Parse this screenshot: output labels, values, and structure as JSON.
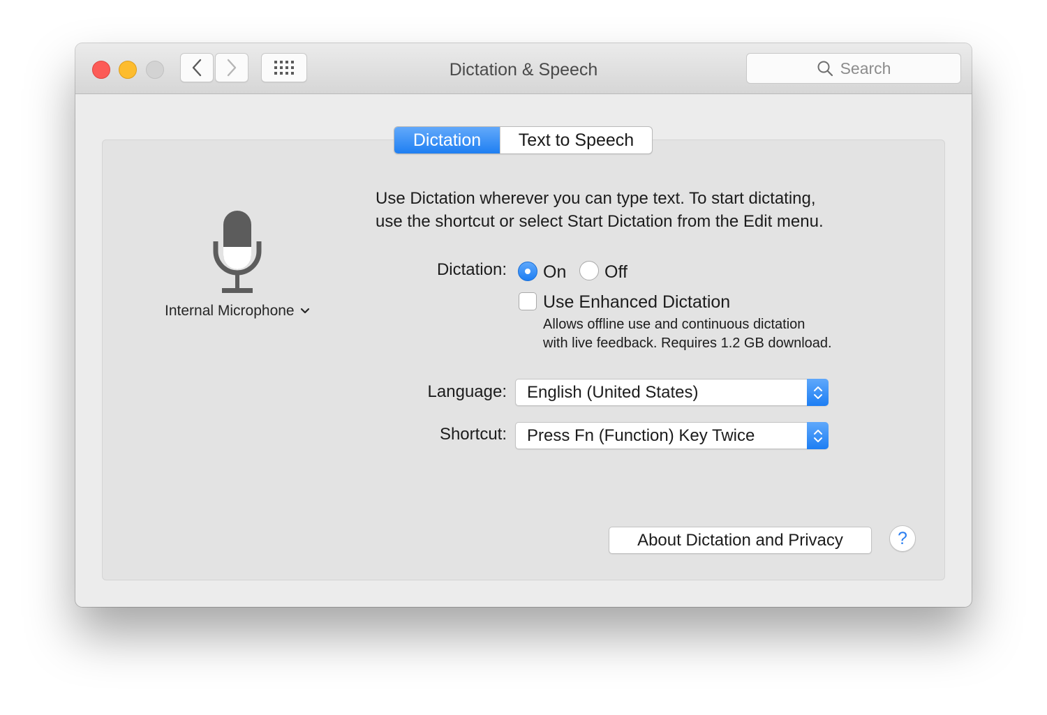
{
  "window": {
    "title": "Dictation & Speech"
  },
  "toolbar": {
    "search_placeholder": "Search",
    "back_icon": "chevron-left-icon",
    "forward_icon": "chevron-right-icon",
    "grid_icon": "show-all-grid-icon"
  },
  "tabs": [
    {
      "label": "Dictation",
      "selected": true
    },
    {
      "label": "Text to Speech",
      "selected": false
    }
  ],
  "microphone": {
    "label": "Internal Microphone",
    "icon": "microphone-icon"
  },
  "intro_text": [
    "Use Dictation wherever you can type text. To start dictating,",
    "use the shortcut or select Start Dictation from the Edit menu."
  ],
  "dictation": {
    "label": "Dictation:",
    "options": [
      {
        "label": "On",
        "selected": true
      },
      {
        "label": "Off",
        "selected": false
      }
    ]
  },
  "enhanced": {
    "label": "Use Enhanced Dictation",
    "checked": false,
    "hint": [
      "Allows offline use and continuous dictation",
      "with live feedback. Requires 1.2 GB download."
    ]
  },
  "language": {
    "label": "Language:",
    "value": "English (United States)"
  },
  "shortcut": {
    "label": "Shortcut:",
    "value": "Press Fn (Function) Key Twice"
  },
  "buttons": {
    "about": "About Dictation and Privacy",
    "help": "?"
  },
  "colors": {
    "accent": "#1f7ff2",
    "close": "#fc5b57",
    "minimize": "#fdbc2e",
    "zoom_disabled": "#d3d3d3"
  }
}
